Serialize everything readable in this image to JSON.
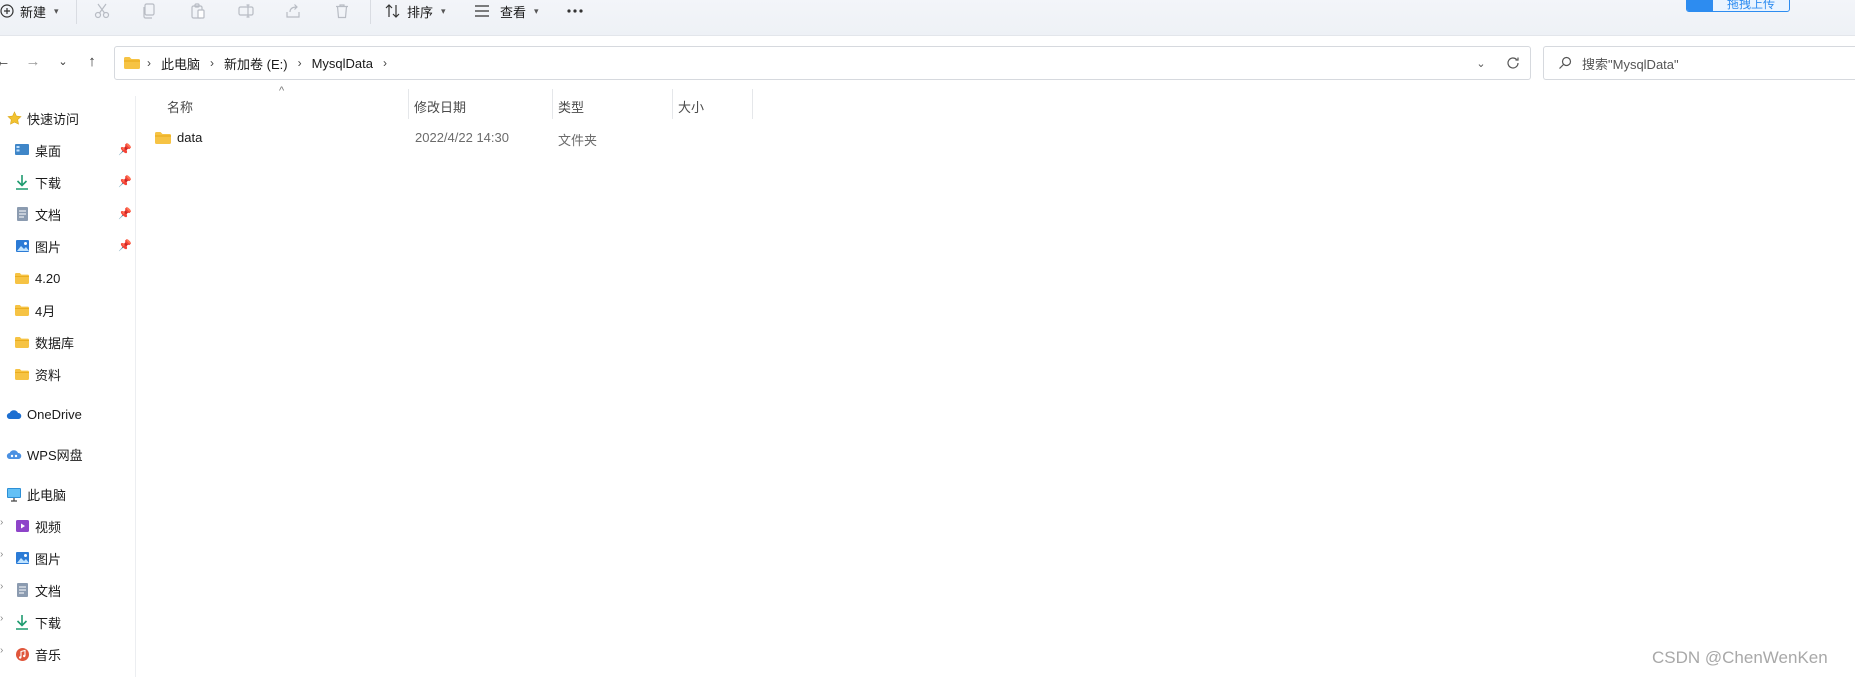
{
  "toolbar": {
    "new_label": "新建",
    "sort_label": "排序",
    "view_label": "查看",
    "upload_logo": "baidu",
    "upload_label": "拖拽上传"
  },
  "address": {
    "crumbs": [
      "此电脑",
      "新加卷 (E:)",
      "MysqlData"
    ]
  },
  "search": {
    "placeholder": "搜索\"MysqlData\""
  },
  "sidebar": {
    "quick_access": "快速访问",
    "pinned": [
      {
        "label": "桌面",
        "icon": "desktop-icon"
      },
      {
        "label": "下载",
        "icon": "download-icon"
      },
      {
        "label": "文档",
        "icon": "document-icon"
      },
      {
        "label": "图片",
        "icon": "picture-icon"
      }
    ],
    "folders": [
      {
        "label": "4.20",
        "icon": "folder-icon"
      },
      {
        "label": "4月",
        "icon": "folder-icon"
      },
      {
        "label": "数据库",
        "icon": "folder-icon"
      },
      {
        "label": "资料",
        "icon": "folder-icon"
      }
    ],
    "onedrive": "OneDrive",
    "wps": "WPS网盘",
    "this_pc": "此电脑",
    "pc_items": [
      {
        "label": "视频",
        "icon": "video-icon"
      },
      {
        "label": "图片",
        "icon": "picture-icon"
      },
      {
        "label": "文档",
        "icon": "document-icon"
      },
      {
        "label": "下载",
        "icon": "download-icon"
      },
      {
        "label": "音乐",
        "icon": "music-icon"
      }
    ]
  },
  "columns": {
    "name": "名称",
    "date": "修改日期",
    "type": "类型",
    "size": "大小"
  },
  "files": [
    {
      "name": "data",
      "date": "2022/4/22 14:30",
      "type": "文件夹",
      "size": ""
    }
  ],
  "watermark": "CSDN @ChenWenKen",
  "colors": {
    "accent": "#2d8cf0",
    "folder": "#f6c344",
    "folder_dark": "#e8a817"
  }
}
